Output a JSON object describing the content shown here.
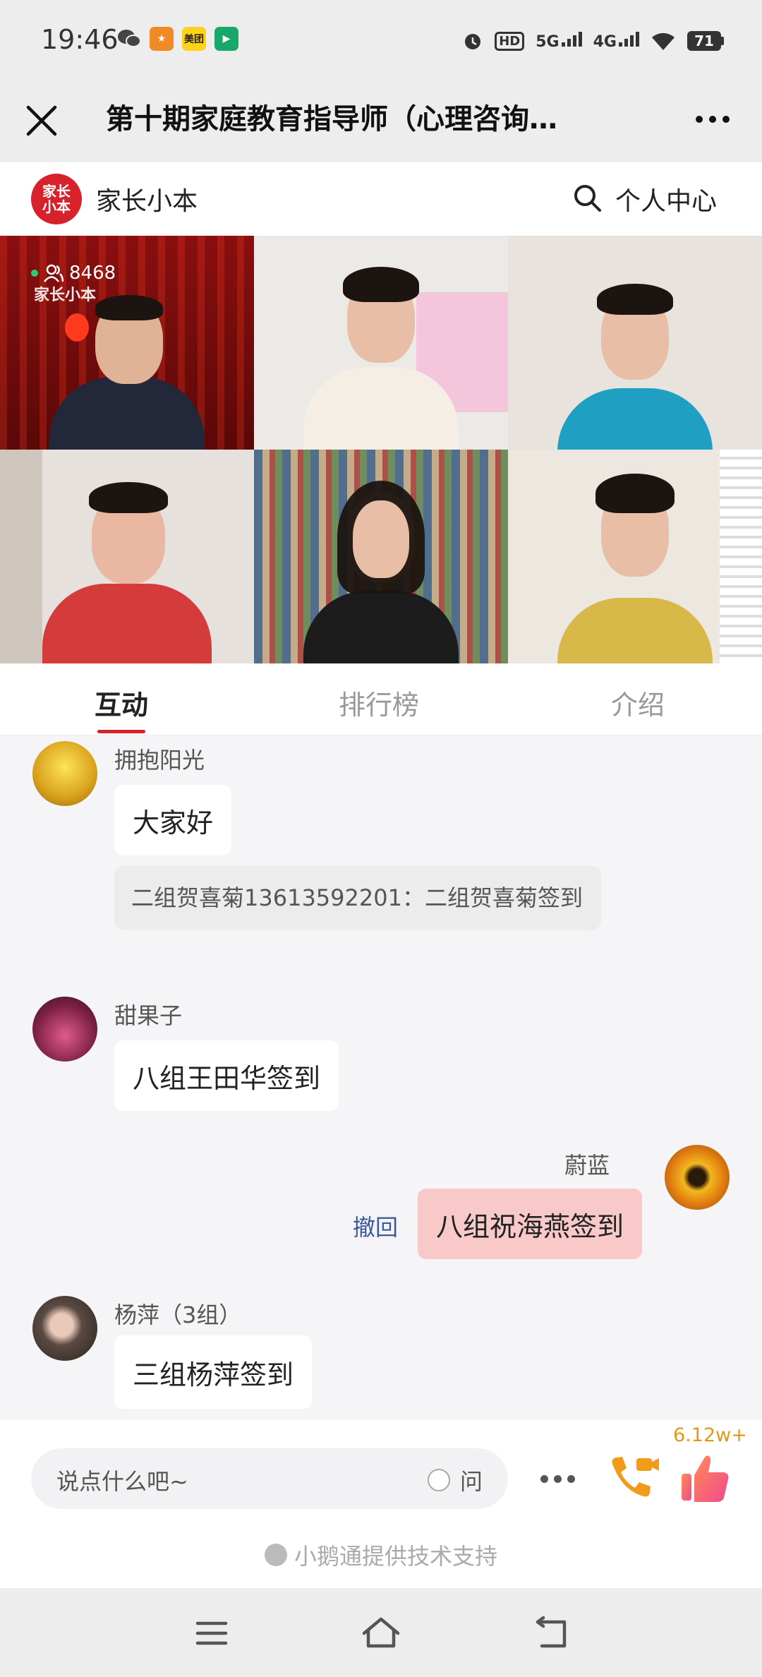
{
  "status_bar": {
    "time": "19:46",
    "network_1": "5G",
    "network_2": "4G",
    "hd_label": "HD",
    "battery": "71",
    "app_icons": [
      "wechat-icon",
      "app-icon",
      "meituan-icon",
      "video-app-icon"
    ],
    "meituan_label": "美团"
  },
  "header": {
    "title": "第十期家庭教育指导师（心理咨询…"
  },
  "brand": {
    "logo_text": "家长小本",
    "name": "家长小本",
    "personal_center": "个人中心",
    "brand_color": "#d8222b"
  },
  "live": {
    "viewer_count": "8468",
    "watermark": "家长小本"
  },
  "tabs": [
    {
      "label": "互动",
      "active": true
    },
    {
      "label": "排行榜",
      "active": false
    },
    {
      "label": "介绍",
      "active": false
    }
  ],
  "messages": [
    {
      "sender": "拥抱阳光",
      "text": "大家好",
      "mine": false
    },
    {
      "system": "二组贺喜菊13613592201：二组贺喜菊签到"
    },
    {
      "sender": "甜果子",
      "text": "八组王田华签到",
      "mine": false
    },
    {
      "sender": "蔚蓝",
      "text": "八组祝海燕签到",
      "mine": true,
      "recall": "撤回"
    },
    {
      "sender": "杨萍（3组）",
      "text": "三组杨萍签到",
      "mine": false
    }
  ],
  "input": {
    "placeholder": "说点什么吧~",
    "ask_label": "问",
    "like_count": "6.12w+"
  },
  "footer": {
    "tech_support": "小鹅通提供技术支持"
  }
}
